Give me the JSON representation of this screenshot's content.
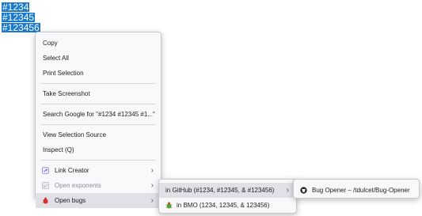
{
  "selection": [
    "#1234",
    "#12345",
    "#123456"
  ],
  "context_menu": {
    "copy": "Copy",
    "select_all": "Select All",
    "print_selection": "Print Selection",
    "take_screenshot": "Take Screenshot",
    "search_google": "Search Google for \"#1234 #12345 #1...\"",
    "view_selection_source": "View Selection Source",
    "inspect": "Inspect (Q)",
    "link_creator": "Link Creator",
    "open_exponents": "Open exponents",
    "open_bugs": "Open bugs"
  },
  "open_bugs_submenu": {
    "github": "in GitHub (#1234, #12345, & #123456)",
    "bmo": "in BMO (1234, 12345, & 123456)"
  },
  "github_submenu": {
    "bug_opener": "Bug Opener – /tdulcet/Bug-Opener"
  },
  "colors": {
    "selection": "#1a7acc",
    "menu_bg": "#f9f9fb",
    "highlight": "#e0e0e6"
  },
  "icons": {
    "link_creator": "link-creator-icon",
    "open_exponents": "exponents-icon",
    "open_bugs": "bug-icon",
    "bmo": "bmo-bug-icon",
    "github": "github-icon"
  }
}
